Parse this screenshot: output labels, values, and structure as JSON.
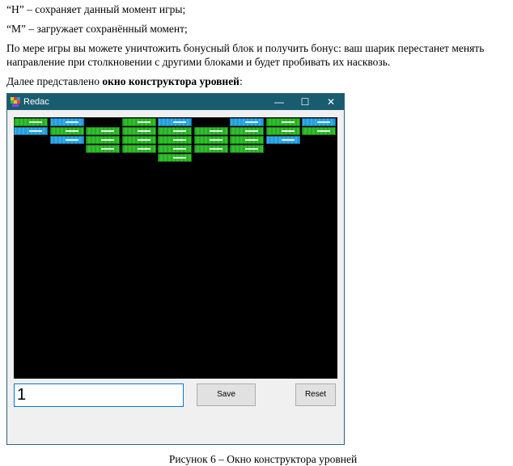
{
  "doc": {
    "line_h": "“H” – сохраняет данный момент игры;",
    "line_m": "“M” – загружает сохранённый момент;",
    "bonus_text": "По мере игры вы можете уничтожить бонусный блок и получить бонус: ваш шарик перестанет менять направление при столкновении с другими блоками и будет пробивать их насквозь.",
    "intro_prefix": "Далее представлено ",
    "intro_bold": "окно конструктора уровней",
    "intro_suffix": ":",
    "caption": "Рисунок 6 – Окно конструктора уровней"
  },
  "window": {
    "title": "Redac",
    "minimize": "—",
    "maximize": "☐",
    "close": "✕"
  },
  "editor": {
    "level_value": "1",
    "save_label": "Save",
    "reset_label": "Reset",
    "blocks": [
      [
        "green",
        "blue",
        null,
        "green",
        "blue",
        null,
        "blue",
        "green",
        "blue"
      ],
      [
        "blue",
        "green",
        "green",
        "green",
        "green",
        "green",
        "green",
        "green",
        "green"
      ],
      [
        null,
        "blue",
        "green",
        "green",
        "green",
        "green",
        "green",
        "blue",
        null
      ],
      [
        null,
        null,
        "green",
        "green",
        "green",
        "green",
        "green",
        null,
        null
      ],
      [
        null,
        null,
        null,
        null,
        "green",
        null,
        null,
        null,
        null
      ]
    ]
  },
  "colors": {
    "titlebar": "#1a5c6f",
    "green_block": "#2ec12a",
    "blue_block": "#1f9fe0",
    "game_bg": "#000000"
  }
}
